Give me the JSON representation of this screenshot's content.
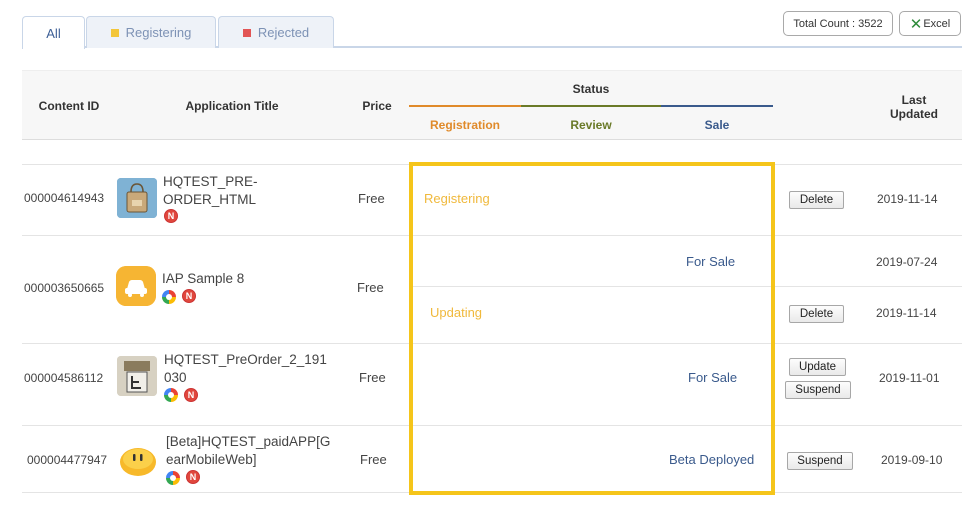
{
  "tabs": [
    {
      "label": "All",
      "marker_color": ""
    },
    {
      "label": "Registering",
      "marker_color": "#f3c63a"
    },
    {
      "label": "Rejected",
      "marker_color": "#e25555"
    }
  ],
  "toolbar": {
    "total_count_label": "Total Count : 3522",
    "excel_label": "Excel"
  },
  "table": {
    "headers": {
      "content_id": "Content ID",
      "app_title": "Application Title",
      "price": "Price",
      "status": "Status",
      "last_updated": "Last Updated",
      "registration": "Registration",
      "review": "Review",
      "sale": "Sale"
    },
    "colors": {
      "registration": "#e08a2a",
      "review": "#6a7a28",
      "sale": "#3a5a8c",
      "highlight": "#f5c51a"
    },
    "rows": [
      {
        "content_id": "000004614943",
        "title_line1": "HQTEST_PRE-",
        "title_line2": "ORDER_HTML",
        "price": "Free",
        "icon": "shopping-bag-icon",
        "badges": [
          "N"
        ],
        "lines": [
          {
            "status": "Registering",
            "date": "2019-11-14",
            "actions": [
              "Delete"
            ]
          }
        ]
      },
      {
        "content_id": "000003650665",
        "title_line1": "IAP Sample 8",
        "title_line2": "",
        "price": "Free",
        "icon": "car-icon",
        "badges": [
          "G",
          "N"
        ],
        "lines": [
          {
            "status": "For Sale",
            "date": "2019-07-24",
            "actions": []
          },
          {
            "status": "Updating",
            "date": "2019-11-14",
            "actions": [
              "Delete"
            ]
          }
        ]
      },
      {
        "content_id": "000004586112",
        "title_line1": "HQTEST_PreOrder_2_191",
        "title_line2": "030",
        "price": "Free",
        "icon": "notepad-icon",
        "badges": [
          "G",
          "N"
        ],
        "lines": [
          {
            "status": "For Sale",
            "date": "2019-11-01",
            "actions": [
              "Update",
              "Suspend"
            ]
          }
        ]
      },
      {
        "content_id": "000004477947",
        "title_line1": "[Beta]HQTEST_paidAPP[G",
        "title_line2": "earMobileWeb]",
        "price": "Free",
        "icon": "smiley-face-icon",
        "badges": [
          "G",
          "N"
        ],
        "lines": [
          {
            "status": "Beta Deployed",
            "date": "2019-09-10",
            "actions": [
              "Suspend"
            ]
          }
        ]
      }
    ]
  }
}
